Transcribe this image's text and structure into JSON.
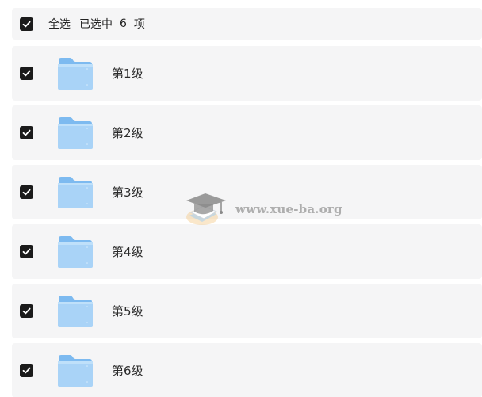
{
  "header": {
    "select_all_label": "全选",
    "selected_prefix": "已选中",
    "selected_count": "6",
    "selected_suffix": "项",
    "checked": true
  },
  "items": [
    {
      "label": "第1级",
      "icon": "folder-icon",
      "checked": true
    },
    {
      "label": "第2级",
      "icon": "folder-icon",
      "checked": true
    },
    {
      "label": "第3级",
      "icon": "folder-icon",
      "checked": true
    },
    {
      "label": "第4级",
      "icon": "folder-icon",
      "checked": true
    },
    {
      "label": "第5级",
      "icon": "folder-icon",
      "checked": true
    },
    {
      "label": "第6级",
      "icon": "folder-icon",
      "checked": true
    }
  ],
  "watermark": {
    "text": "www.xue-ba.org",
    "icon": "graduation-cap-icon"
  },
  "colors": {
    "row_background": "#f5f5f6",
    "checkbox_fill": "#1b1b1b",
    "folder_light": "#a9d3f7",
    "folder_dark": "#7dbaf0"
  }
}
